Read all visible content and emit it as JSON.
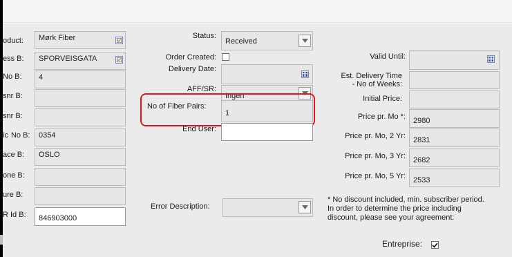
{
  "left_column": [
    {
      "label": "oduct:",
      "value": "Mørk Fiber",
      "picker": true
    },
    {
      "label": "ess B:",
      "value": "SPORVEISGATA",
      "picker": true
    },
    {
      "label": "No B:",
      "value": "4"
    },
    {
      "label": "snr B:",
      "value": ""
    },
    {
      "label": "snr B:",
      "value": ""
    },
    {
      "label": "No B:",
      "value": "0354",
      "prefix": "ic"
    },
    {
      "label": "ace B:",
      "value": "OSLO"
    },
    {
      "label": "one B:",
      "value": ""
    },
    {
      "label": "ure B:",
      "value": ""
    },
    {
      "label": "R Id B:",
      "value": "846903000"
    }
  ],
  "middle": {
    "status_label": "Status:",
    "status_value": "Received",
    "order_created_label": "Order Created:",
    "delivery_date_label": "Delivery Date:",
    "aff_sr_label": "AFF/SR:",
    "aff_sr_value": "Ingen",
    "fiber_pairs_label": "No of Fiber Pairs:",
    "fiber_pairs_value": "1",
    "end_user_label": "End User:",
    "end_user_value": "",
    "error_description_label": "Error Description:",
    "error_description_value": ""
  },
  "right": {
    "valid_until_label": "Valid Until:",
    "est_delivery_label_1": "Est. Delivery Time",
    "est_delivery_label_2": "- No of Weeks:",
    "initial_price_label": "Initial Price:",
    "price_mo_label": "Price pr. Mo *:",
    "price_mo_value": "2980",
    "price_2yr_label": "Price pr. Mo, 2 Yr:",
    "price_2yr_value": "2831",
    "price_3yr_label": "Price pr. Mo, 3 Yr:",
    "price_3yr_value": "2682",
    "price_5yr_label": "Price pr. Mo, 5 Yr:",
    "price_5yr_value": "2533",
    "note_lines": [
      "* No discount included, min. subscriber period.",
      "In order to determine the price including",
      "discount, please see your agreement:"
    ],
    "entreprise_label": "Entreprise:",
    "entreprise_checked": true
  },
  "colors": {
    "highlight": "#e3171b",
    "panel": "#ebebeb"
  },
  "icons": [
    "calendar-icon",
    "dropdown-arrow-icon",
    "checkmark-icon"
  ]
}
